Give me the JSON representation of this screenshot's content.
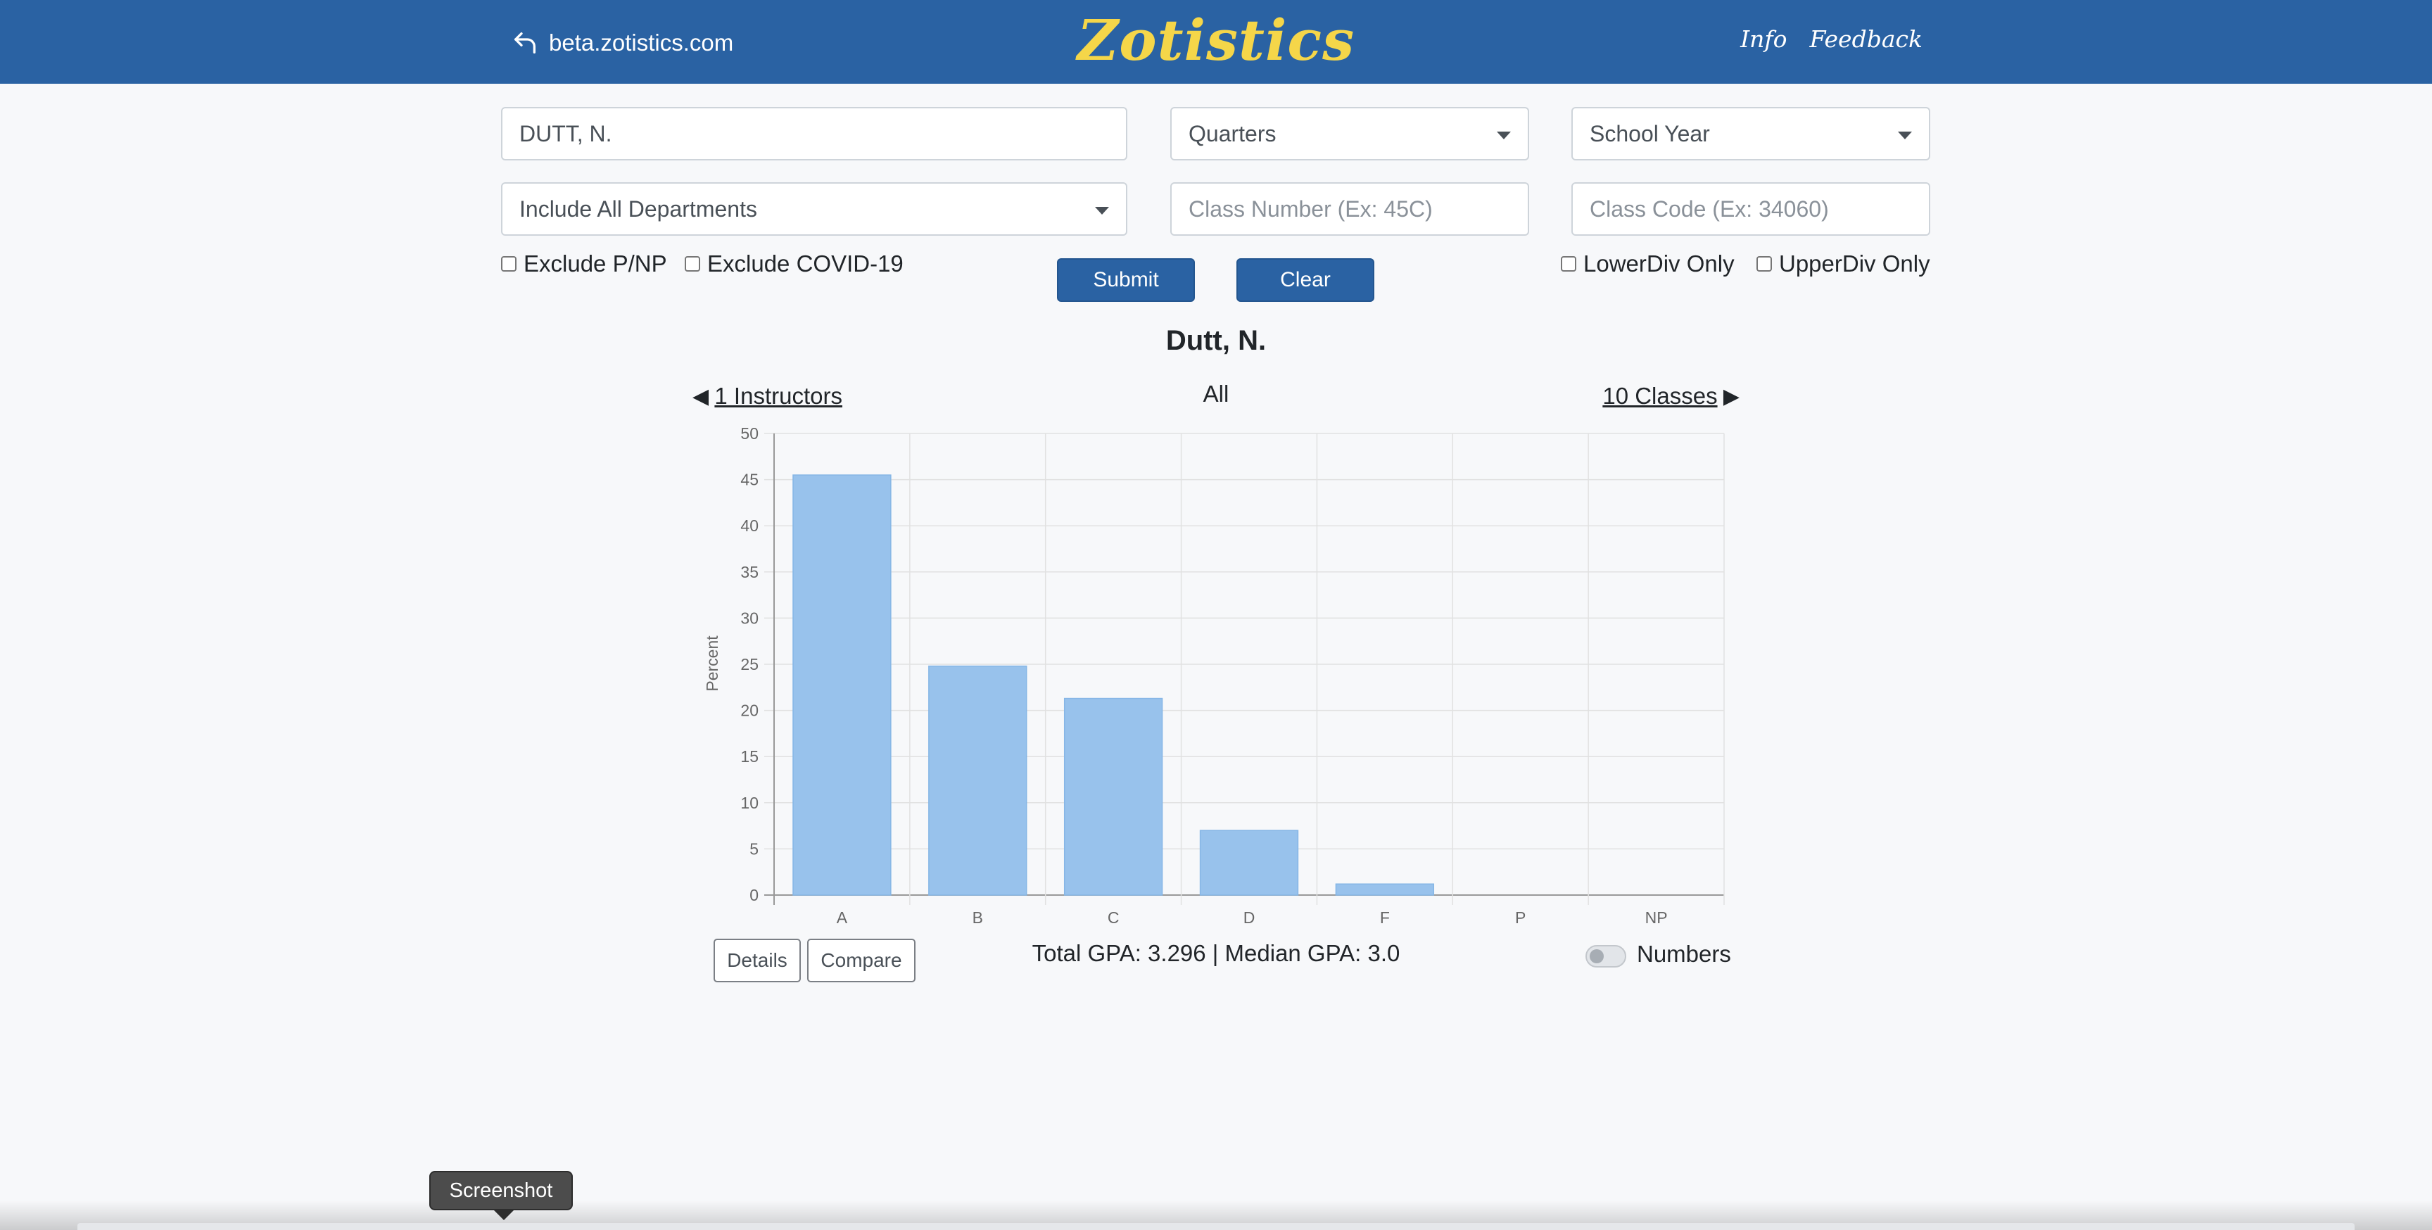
{
  "header": {
    "back_link": "beta.zotistics.com",
    "brand": "Zotistics",
    "nav": [
      "Info",
      "Feedback"
    ],
    "bg_color": "#2a62a3",
    "brand_color": "#f5d649",
    "back_icon": "return-arrow-icon"
  },
  "form": {
    "instructor_value": "DUTT, N.",
    "quarters_select": "Quarters",
    "school_year_select": "School Year",
    "department_select": "Include All Departments",
    "class_number_placeholder": "Class Number (Ex: 45C)",
    "class_code_placeholder": "Class Code (Ex: 34060)",
    "exclude_pnp": "Exclude P/NP",
    "exclude_covid": "Exclude COVID-19",
    "lowerdiv_only": "LowerDiv Only",
    "upperdiv_only": "UpperDiv Only",
    "submit": "Submit",
    "clear": "Clear"
  },
  "results": {
    "title": "Dutt, N.",
    "instructors_link": "1 Instructors",
    "classes_link": "10 Classes",
    "filter_label": "All",
    "details_button": "Details",
    "compare_button": "Compare",
    "gpa_summary": "Total GPA: 3.296 | Median GPA: 3.0",
    "numbers_toggle_label": "Numbers",
    "numbers_toggle_on": false
  },
  "chart_data": {
    "type": "bar",
    "categories": [
      "A",
      "B",
      "C",
      "D",
      "F",
      "P",
      "NP"
    ],
    "values": [
      45.5,
      24.8,
      21.3,
      7.0,
      1.2,
      0,
      0
    ],
    "ylabel": "Percent",
    "xlabel": "",
    "ylim": [
      0,
      50
    ],
    "yticks": [
      0,
      5,
      10,
      15,
      20,
      25,
      30,
      35,
      40,
      45,
      50
    ],
    "grid": true,
    "bar_color": "#98c2ec"
  },
  "tooltip": "Screenshot"
}
